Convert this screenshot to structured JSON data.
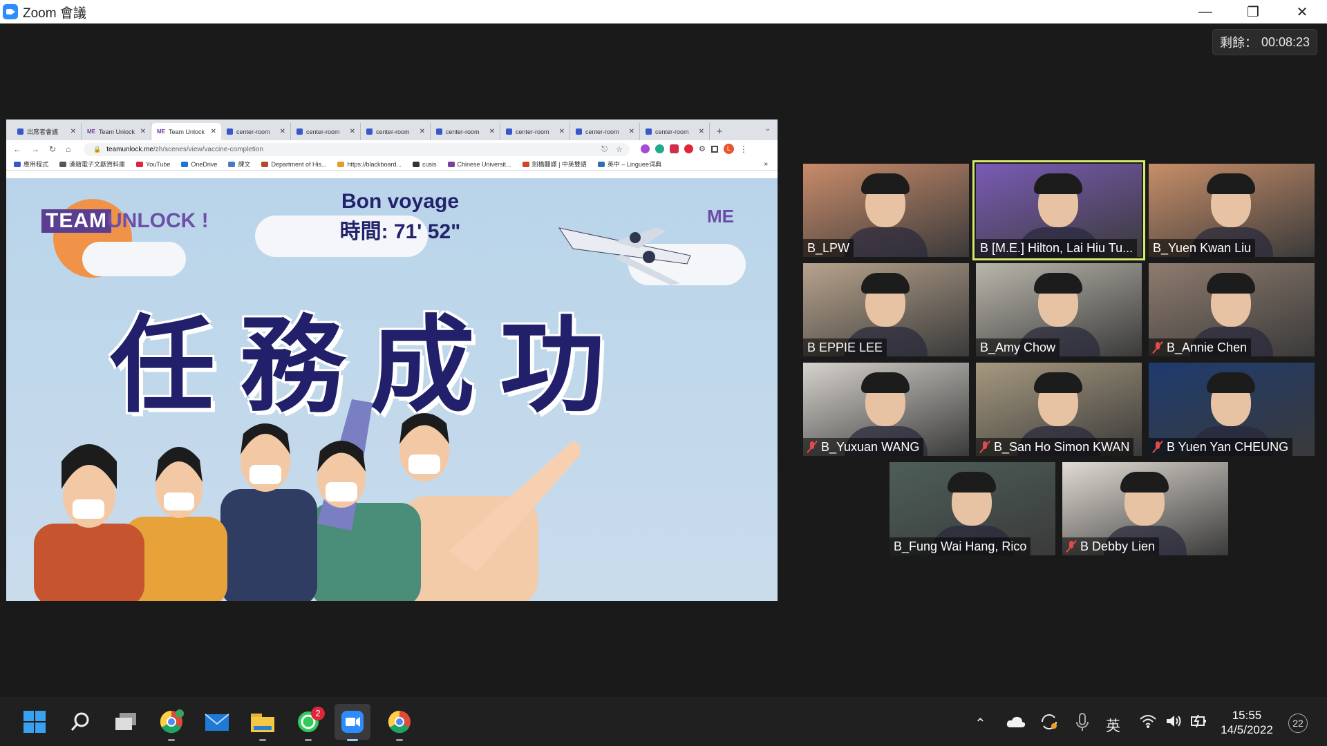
{
  "window": {
    "title": "Zoom 會議"
  },
  "timer": {
    "label": "剩餘：",
    "value": "00:08:23"
  },
  "browser": {
    "tabs": [
      {
        "label": "出席者會議",
        "fav": "zoom"
      },
      {
        "label": "Team Unlock",
        "fav": "me"
      },
      {
        "label": "Team Unlock",
        "fav": "me",
        "active": true
      },
      {
        "label": "center-room",
        "fav": "doc"
      },
      {
        "label": "center-room",
        "fav": "doc"
      },
      {
        "label": "center-room",
        "fav": "doc"
      },
      {
        "label": "center-room",
        "fav": "doc"
      },
      {
        "label": "center-room",
        "fav": "doc"
      },
      {
        "label": "center-room",
        "fav": "doc"
      },
      {
        "label": "center-room",
        "fav": "doc"
      }
    ],
    "url_host": "teamunlock.me",
    "url_path": "/zh/scenes/view/vaccine-completion",
    "bookmarks": [
      "應用程式",
      "漢籍電子文獻資料庫",
      "YouTube",
      "OneDrive",
      "課文",
      "Department of His...",
      "https://blackboard...",
      "cusis",
      "Chinese Universit...",
      "劍橋翻譯 | 中英雙語",
      "英中 – Linguee词典"
    ]
  },
  "game": {
    "logo_a": "TEAM",
    "logo_b": "UNLOCK !",
    "title": "Bon voyage",
    "time": "時間: 71' 52\"",
    "mission": "任務成功",
    "brand": "ME"
  },
  "participants": [
    {
      "name": "B_LPW",
      "muted": false,
      "bg": "#c98b6a"
    },
    {
      "name": "B [M.E.] Hilton, Lai Hiu Tu...",
      "muted": false,
      "bg": "#7a5bb5",
      "active": true
    },
    {
      "name": "B_Yuen Kwan Liu",
      "muted": false,
      "bg": "#c78e68"
    },
    {
      "name": "B EPPIE LEE",
      "muted": false,
      "bg": "#b7a38c"
    },
    {
      "name": "B_Amy Chow",
      "muted": false,
      "bg": "#b9b6ab"
    },
    {
      "name": "B_Annie Chen",
      "muted": true,
      "bg": "#8e7b6e"
    },
    {
      "name": "B_Yuxuan WANG",
      "muted": true,
      "bg": "#d6d2cc"
    },
    {
      "name": "B_San Ho Simon KWAN",
      "muted": true,
      "bg": "#a6997f"
    },
    {
      "name": "B Yuen Yan CHEUNG",
      "muted": true,
      "bg": "#1e3b6e"
    },
    {
      "name": "B_Fung Wai Hang, Rico",
      "muted": false,
      "bg": "#4d5e58"
    },
    {
      "name": "B Debby Lien",
      "muted": true,
      "bg": "#e0dbd3"
    }
  ],
  "taskbar": {
    "badge_whatsapp": "2",
    "ime": "英",
    "time": "15:55",
    "date": "14/5/2022",
    "notifications": "22"
  }
}
